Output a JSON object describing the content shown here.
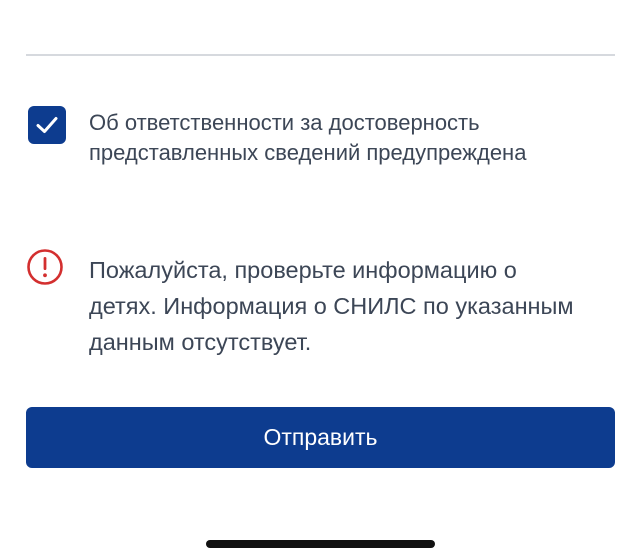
{
  "consent": {
    "checked": true,
    "label": "Об ответственности за достоверность\nпредставленных сведений предупреждена"
  },
  "warning": {
    "icon": "exclamation-circle-icon",
    "message": "Пожалуйста, проверьте информацию о\nдетях. Информация о СНИЛС по указанным\nданным отсутствует."
  },
  "submit": {
    "label": "Отправить"
  },
  "colors": {
    "primary": "#0d3c8f",
    "error": "#d32f2f",
    "text": "#3c4656",
    "divider": "#d6d9de"
  }
}
